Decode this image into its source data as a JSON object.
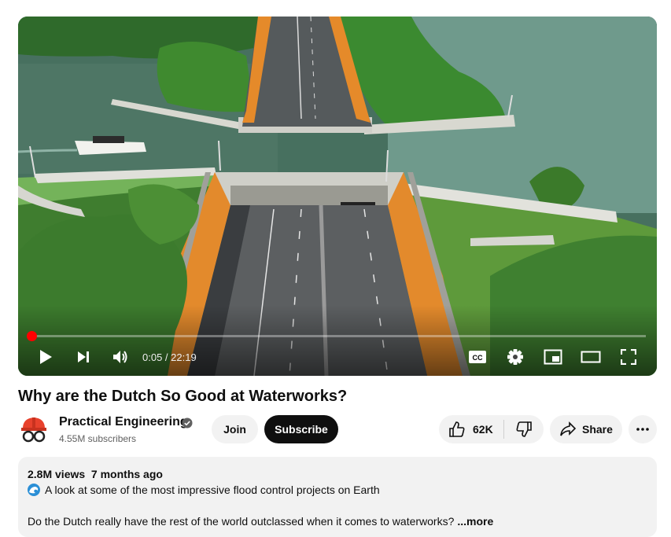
{
  "player": {
    "current_time": "0:05",
    "duration": "22:19",
    "time_separator": " / ",
    "progress_fraction": 0.004,
    "cc_label": "CC"
  },
  "video": {
    "title": "Why are the Dutch So Good at Waterworks?"
  },
  "channel": {
    "name": "Practical Engineering",
    "subscribers": "4.55M subscribers",
    "join_label": "Join",
    "subscribe_label": "Subscribe"
  },
  "actions": {
    "like_count": "62K",
    "share_label": "Share"
  },
  "description": {
    "meta": "2.8M views  7 months ago",
    "line1": "A look at some of the most impressive flood control projects on Earth",
    "line2": "Do the Dutch really have the rest of the world outclassed when it comes to waterworks?",
    "more_label": "...more"
  },
  "icons": [
    "play-icon",
    "next-icon",
    "volume-icon",
    "cc-icon",
    "settings-icon",
    "miniplayer-icon",
    "theater-icon",
    "fullscreen-icon",
    "verified-icon",
    "like-icon",
    "dislike-icon",
    "share-icon",
    "more-icon",
    "wave-icon"
  ],
  "colors": {
    "progress": "#ff0000",
    "subscribe_bg": "#0f0f0f",
    "pill_bg": "#f2f2f2"
  }
}
